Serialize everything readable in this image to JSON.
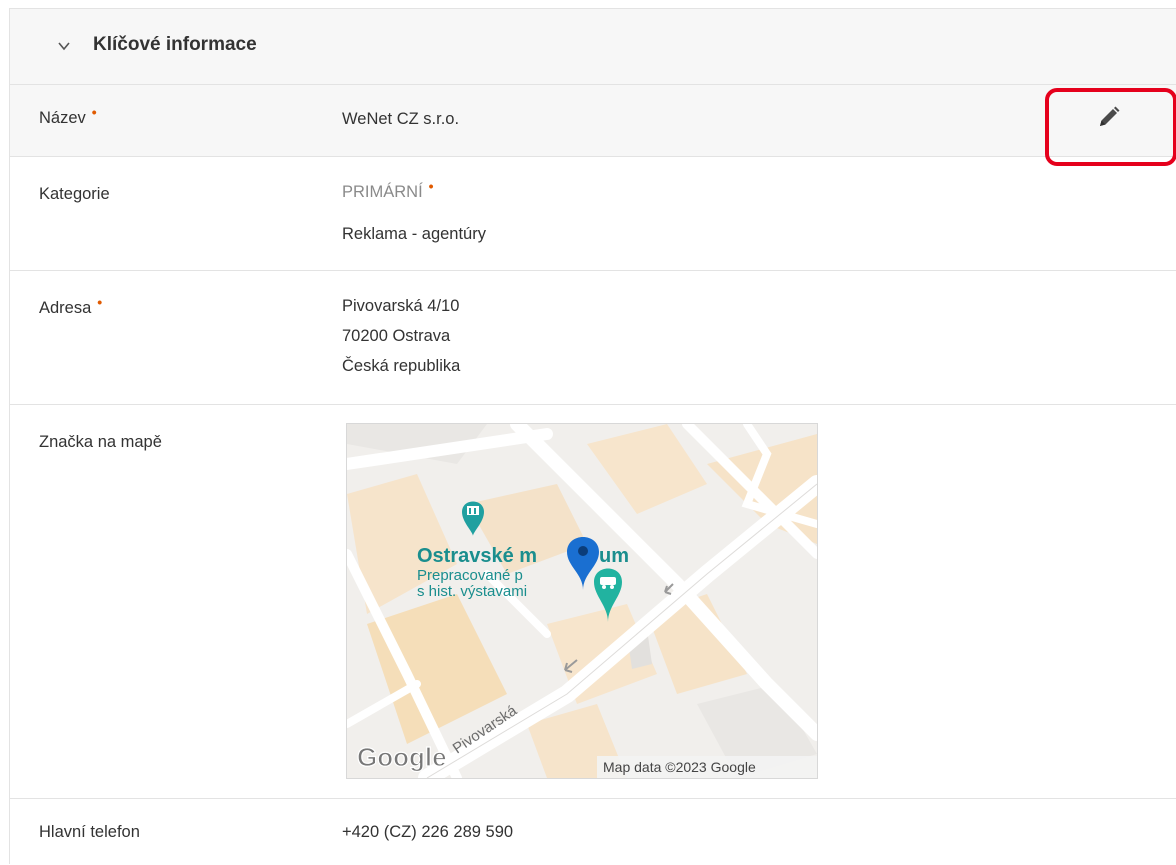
{
  "section": {
    "title": "Klíčové informace",
    "expanded_icon": "chevron-down-icon"
  },
  "fields": {
    "name": {
      "label": "Název",
      "required_mark": "•",
      "value": "WeNet CZ s.r.o.",
      "edit_icon": "pencil-icon"
    },
    "category": {
      "label": "Kategorie",
      "primary_label": "PRIMÁRNÍ",
      "required_mark": "•",
      "value": "Reklama - agentúry"
    },
    "address": {
      "label": "Adresa",
      "required_mark": "•",
      "line1": "Pivovarská 4/10",
      "line2": "70200 Ostrava",
      "line3": "Česká republika"
    },
    "map": {
      "label": "Značka na mapě",
      "place_name": "Ostravské muzeum",
      "place_name_partial_left": "Ostravské m",
      "place_name_partial_right": "um",
      "place_desc_line1": "Prepracované p",
      "place_desc_line2": "s hist. výstavami",
      "street": "Pivovarská",
      "logo_text": "Google",
      "attribution": "Map data ©2023 Google"
    },
    "phone": {
      "label": "Hlavní telefon",
      "value": "+420 (CZ) 226 289 590"
    }
  },
  "colors": {
    "required": "#e05a00",
    "highlight": "#e5001c",
    "museum_teal": "#20a0a0",
    "pin_blue": "#1a6fd1"
  }
}
